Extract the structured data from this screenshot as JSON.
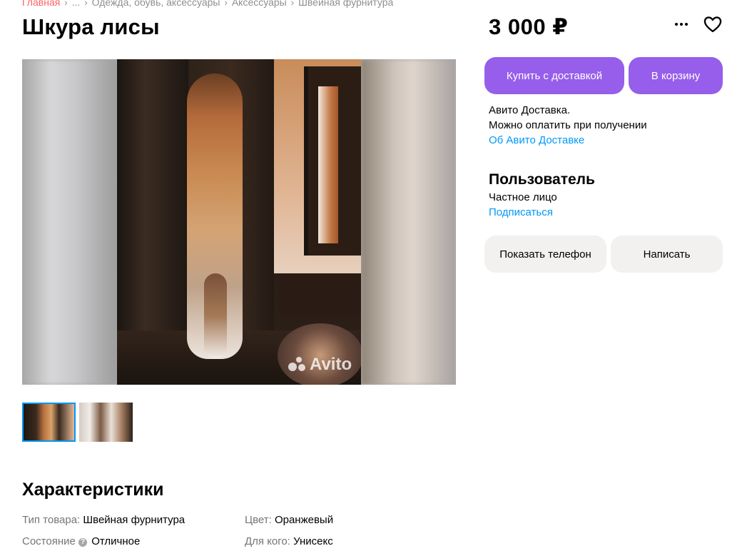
{
  "breadcrumb": {
    "items": [
      "Главная",
      "...",
      "Одежда, обувь, аксессуары",
      "Аксессуары",
      "Швейная фурнитура"
    ]
  },
  "listing": {
    "title": "Шкура лисы",
    "price": "3 000 ₽"
  },
  "gallery": {
    "watermark": "Avito",
    "thumbnail_count": 2,
    "active_thumbnail": 1
  },
  "actions": {
    "buy_with_delivery": "Купить с доставкой",
    "add_to_cart": "В корзину"
  },
  "delivery": {
    "line1": "Авито Доставка.",
    "line2": "Можно оплатить при получении",
    "link": "Об Авито Доставке"
  },
  "seller": {
    "name": "Пользователь",
    "type": "Частное лицо",
    "subscribe": "Подписаться"
  },
  "contact": {
    "show_phone": "Показать телефон",
    "write": "Написать"
  },
  "characteristics": {
    "title": "Характеристики",
    "items": [
      {
        "key": "Тип товара:",
        "value": "Швейная фурнитура"
      },
      {
        "key": "Цвет:",
        "value": "Оранжевый"
      },
      {
        "key": "Состояние",
        "value": "Отличное"
      },
      {
        "key": "Для кого:",
        "value": "Унисекс"
      }
    ]
  },
  "colors": {
    "accent": "#965eeb",
    "link": "#0099f7",
    "breadcrumb_home": "#ff6163",
    "secondary_button": "#f2f1f0"
  },
  "icons": {
    "more": "more-dots-icon",
    "favorite": "heart-icon",
    "help": "question-icon"
  }
}
